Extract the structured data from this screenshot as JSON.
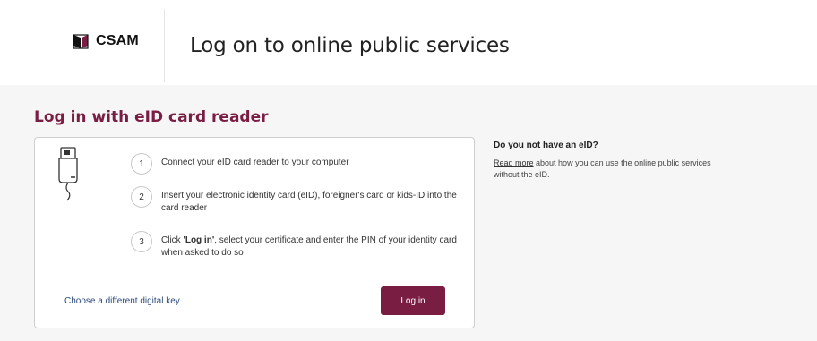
{
  "header": {
    "logo_text": "CSAM",
    "title": "Log on to online public services"
  },
  "main": {
    "section_title": "Log in with eID card reader",
    "steps": [
      {
        "number": "1",
        "text": "Connect your eID card reader to your computer"
      },
      {
        "number": "2",
        "text": "Insert your electronic identity card (eID), foreigner's card or kids-ID into the card reader"
      },
      {
        "number": "3",
        "text_prefix": "Click ",
        "text_bold": "'Log in'",
        "text_suffix": ", select your certificate and enter the PIN of your identity card when asked to do so"
      }
    ],
    "alt_link": "Choose a different digital key",
    "login_button": "Log in"
  },
  "info": {
    "title": "Do you not have an eID?",
    "link_text": "Read more",
    "text": " about how you can use the online public services without the eID."
  },
  "colors": {
    "accent": "#7a1d43",
    "link": "#2c4a7a",
    "background": "#f6f6f6"
  },
  "icons": [
    "csam-logo-icon",
    "card-reader-icon"
  ]
}
